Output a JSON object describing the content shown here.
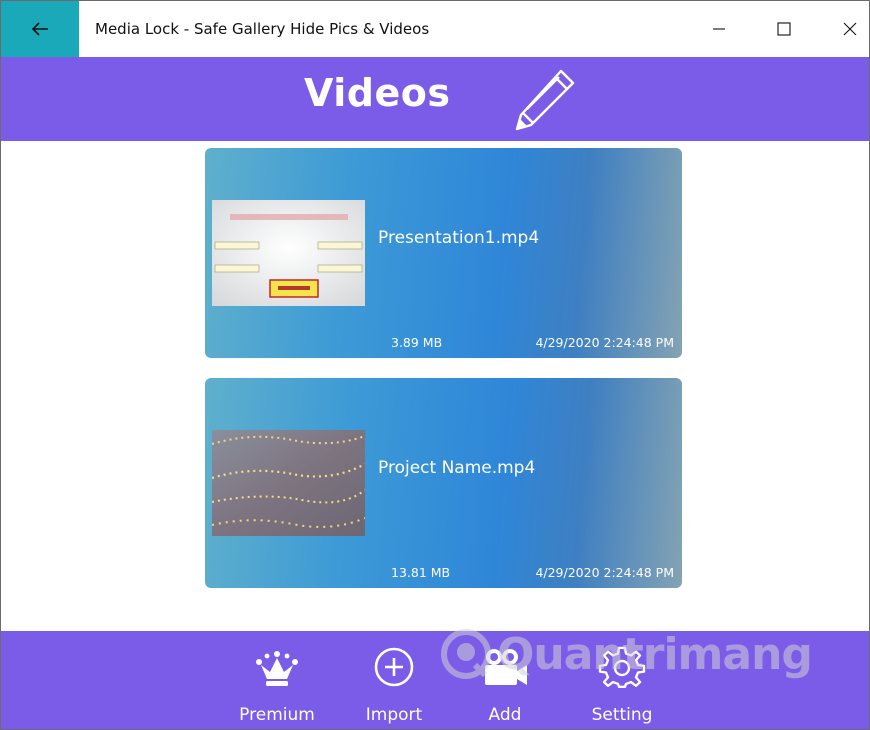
{
  "window": {
    "title": "Media Lock - Safe Gallery Hide Pics & Videos"
  },
  "header": {
    "title": "Videos"
  },
  "videos": [
    {
      "name": "Presentation1.mp4",
      "size": "3.89  MB",
      "date": "4/29/2020 2:24:48 PM",
      "thumbnail": "quiz-slide-thumbnail"
    },
    {
      "name": "Project Name.mp4",
      "size": "13.81  MB",
      "date": "4/29/2020 2:24:48 PM",
      "thumbnail": "string-lights-thumbnail"
    }
  ],
  "bottom_nav": [
    {
      "label": "Premium",
      "icon": "crown-icon"
    },
    {
      "label": "Import",
      "icon": "plus-circle-icon"
    },
    {
      "label": "Add",
      "icon": "video-camera-icon"
    },
    {
      "label": "Setting",
      "icon": "gear-icon"
    }
  ],
  "watermark": {
    "text": "Quantrimang"
  },
  "colors": {
    "accent": "#7b5ce8",
    "back_button": "#1aa9b8",
    "card_gradient_start": "#5fb0cc",
    "card_gradient_mid": "#2f86d8",
    "card_gradient_end": "#84a3b3"
  }
}
